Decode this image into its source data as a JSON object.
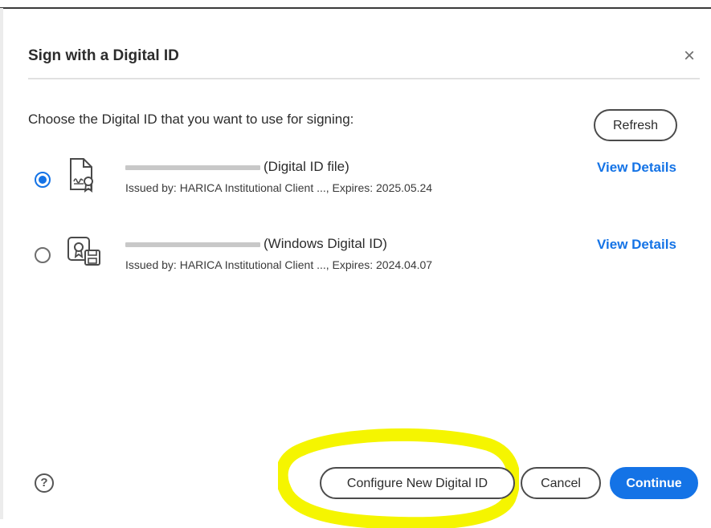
{
  "dialog": {
    "title": "Sign with a Digital ID",
    "close_glyph": "×",
    "prompt": "Choose the Digital ID that you want to use for signing:",
    "refresh_label": "Refresh",
    "help_glyph": "?"
  },
  "ids": [
    {
      "name_visible": "(Digital ID file)",
      "issuer": "Issued by: HARICA Institutional Client ..., Expires: 2025.05.24",
      "view_label": "View Details",
      "selected": true,
      "icon": "certificate-file-icon"
    },
    {
      "name_visible": "(Windows Digital ID)",
      "issuer": "Issued by: HARICA Institutional Client ..., Expires: 2024.04.07",
      "view_label": "View Details",
      "selected": false,
      "icon": "windows-certificate-icon"
    }
  ],
  "footer": {
    "configure_label": "Configure New Digital ID",
    "cancel_label": "Cancel",
    "continue_label": "Continue"
  },
  "colors": {
    "accent": "#1473e6",
    "highlight": "#f5f500"
  }
}
